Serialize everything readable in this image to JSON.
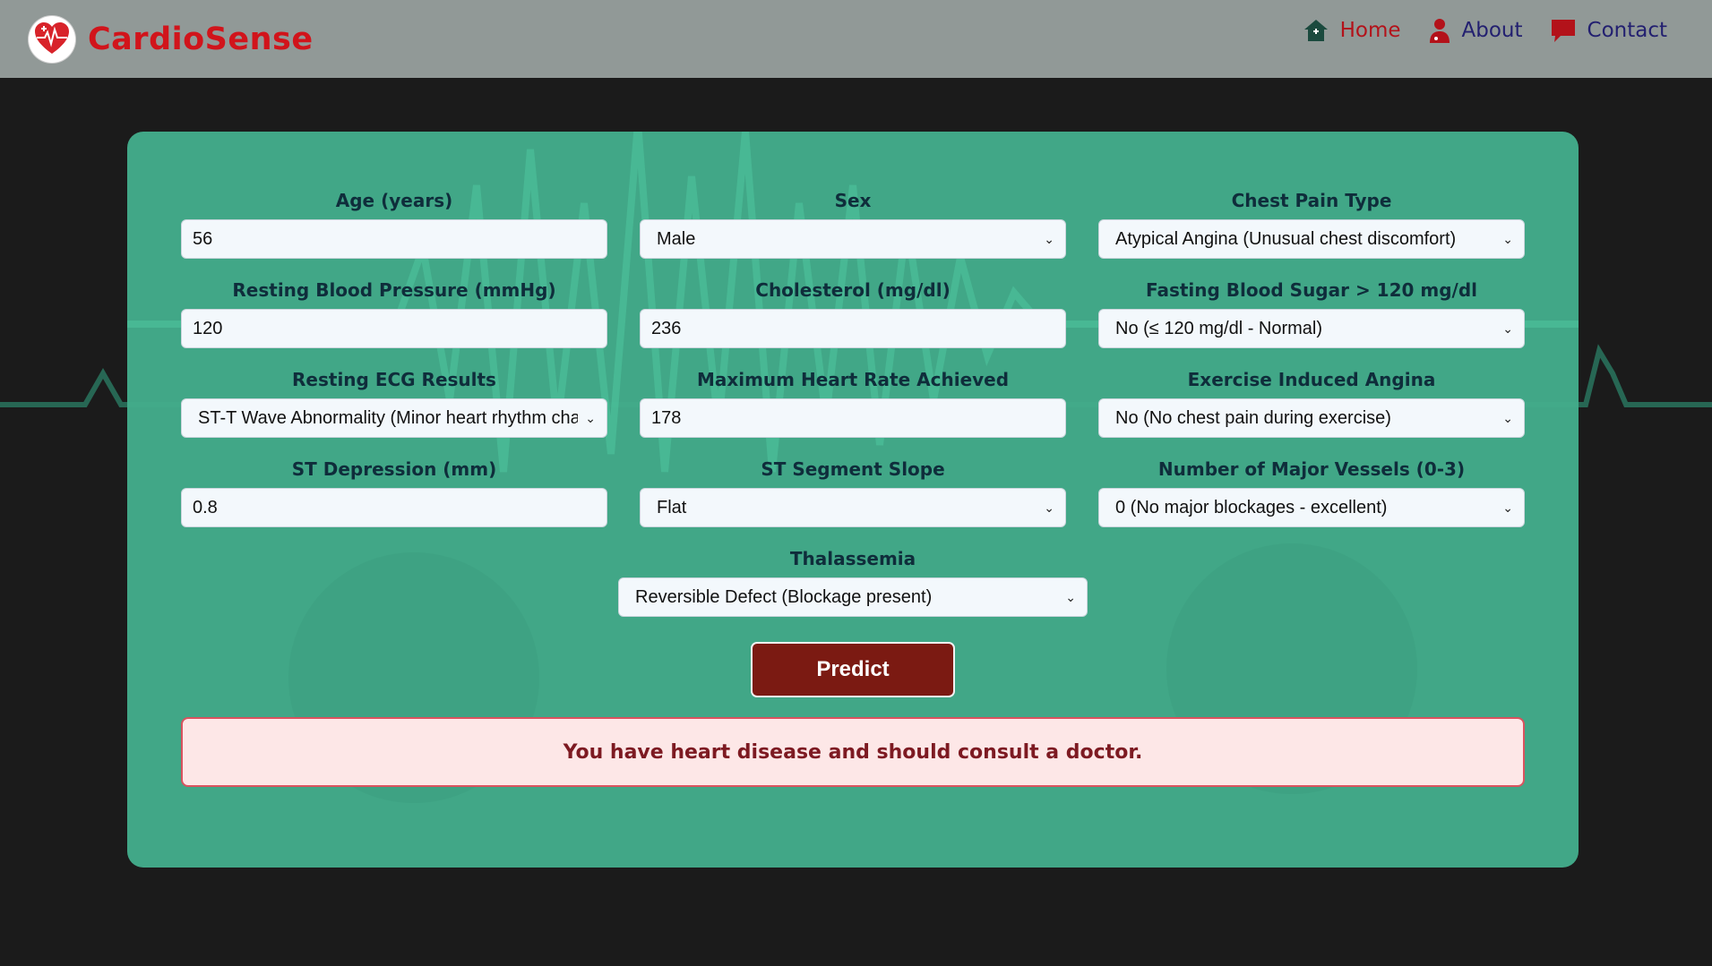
{
  "brand": {
    "name": "CardioSense",
    "logo_icon": "heart-pulse-icon",
    "color": "#d1141b"
  },
  "nav": [
    {
      "label": "Home",
      "icon": "home-icon",
      "color": "#b3121a"
    },
    {
      "label": "About",
      "icon": "doctor-icon",
      "color": "#232070"
    },
    {
      "label": "Contact",
      "icon": "chat-icon",
      "color": "#232070"
    }
  ],
  "form": {
    "age": {
      "label": "Age (years)",
      "value": "56"
    },
    "sex": {
      "label": "Sex",
      "value": "Male"
    },
    "chest_pain": {
      "label": "Chest Pain Type",
      "value": "Atypical Angina (Unusual chest discomfort)"
    },
    "bp": {
      "label": "Resting Blood Pressure (mmHg)",
      "value": "120"
    },
    "chol": {
      "label": "Cholesterol (mg/dl)",
      "value": "236"
    },
    "fbs": {
      "label": "Fasting Blood Sugar > 120 mg/dl",
      "value": "No (≤ 120 mg/dl - Normal)"
    },
    "ecg": {
      "label": "Resting ECG Results",
      "value": "ST-T Wave Abnormality (Minor heart rhythm cha"
    },
    "max_hr": {
      "label": "Maximum Heart Rate Achieved",
      "value": "178"
    },
    "angina": {
      "label": "Exercise Induced Angina",
      "value": "No (No chest pain during exercise)"
    },
    "st_dep": {
      "label": "ST Depression (mm)",
      "value": "0.8"
    },
    "slope": {
      "label": "ST Segment Slope",
      "value": "Flat"
    },
    "vessels": {
      "label": "Number of Major Vessels (0-3)",
      "value": "0 (No major blockages - excellent)"
    },
    "thal": {
      "label": "Thalassemia",
      "value": "Reversible Defect (Blockage present)"
    }
  },
  "predict_label": "Predict",
  "result_text": "You have heart disease and should consult a doctor.",
  "colors": {
    "card": "#43ac8b",
    "button": "#7b1a12",
    "result_bg": "#fde7e7",
    "result_text": "#7d1a22"
  }
}
